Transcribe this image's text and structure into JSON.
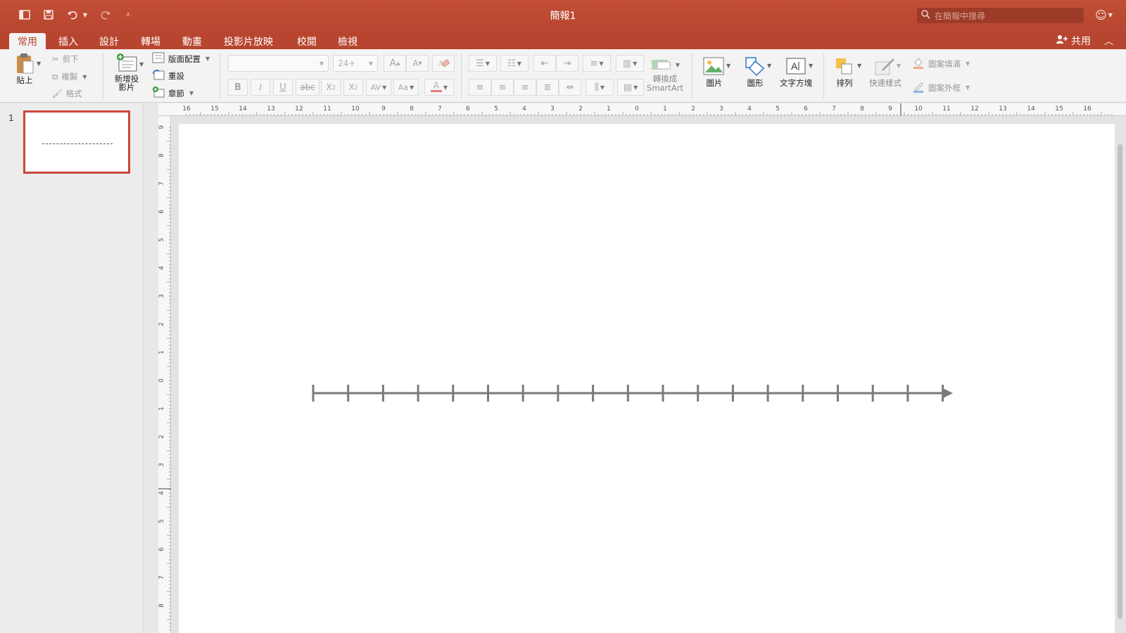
{
  "window": {
    "title": "簡報1"
  },
  "quick_access": [
    "sidebar-toggle-icon",
    "save-icon",
    "undo-icon",
    "redo-icon",
    "customize-icon"
  ],
  "search": {
    "placeholder": "在簡報中搜尋"
  },
  "tabs": [
    {
      "label": "常用",
      "active": true
    },
    {
      "label": "插入",
      "active": false
    },
    {
      "label": "設計",
      "active": false
    },
    {
      "label": "轉場",
      "active": false
    },
    {
      "label": "動畫",
      "active": false
    },
    {
      "label": "投影片放映",
      "active": false
    },
    {
      "label": "校閱",
      "active": false
    },
    {
      "label": "檢視",
      "active": false
    }
  ],
  "share": {
    "label": "共用"
  },
  "ribbon": {
    "paste": "貼上",
    "cut": "剪下",
    "copy": "複製",
    "format": "格式",
    "new_slide": "新增投影片",
    "layout": "版面配置",
    "reset": "重設",
    "section": "章節",
    "font_size": "24+",
    "convert_smartart_1": "轉換成",
    "convert_smartart_2": "SmartArt",
    "picture": "圖片",
    "shape": "圖形",
    "textbox": "文字方塊",
    "arrange": "排列",
    "quick_styles": "快速樣式",
    "shape_fill": "圖案填滿",
    "shape_outline": "圖案外框"
  },
  "slides": [
    {
      "number": "1"
    }
  ],
  "horizontal_ruler_labels": [
    "16",
    "15",
    "14",
    "13",
    "12",
    "11",
    "10",
    "9",
    "8",
    "7",
    "6",
    "5",
    "4",
    "3",
    "2",
    "1",
    "0",
    "1",
    "2",
    "3",
    "4",
    "5",
    "6",
    "7",
    "8",
    "9",
    "10",
    "11",
    "12",
    "13",
    "14",
    "15",
    "16"
  ],
  "vertical_ruler_labels": [
    "9",
    "8",
    "7",
    "6",
    "5",
    "4",
    "3",
    "2",
    "1",
    "0",
    "1",
    "2",
    "3",
    "4",
    "5",
    "6",
    "7",
    "8"
  ],
  "number_line": {
    "tick_count": 19,
    "arrow": "right",
    "color": "#7a7a7a"
  },
  "colors": {
    "accent": "#b8452f",
    "selected_slide_border": "#c9483a"
  }
}
